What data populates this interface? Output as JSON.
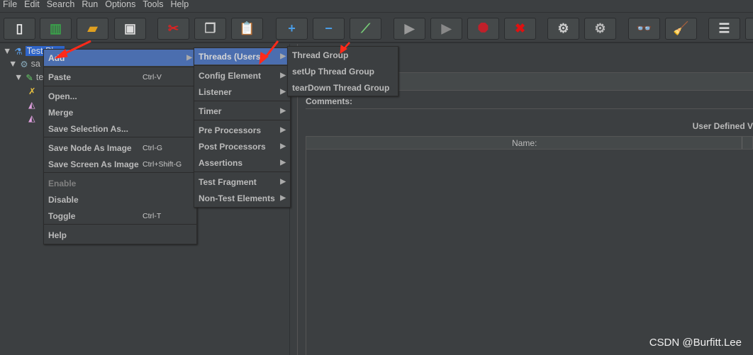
{
  "menubar": [
    "File",
    "Edit",
    "Search",
    "Run",
    "Options",
    "Tools",
    "Help"
  ],
  "toolbar": [
    {
      "icon": "new-icon",
      "g": "▯",
      "c": "#eee"
    },
    {
      "icon": "templates-icon",
      "g": "▥",
      "c": "#3aa34a"
    },
    {
      "icon": "open-icon",
      "g": "▰",
      "c": "#e0a020"
    },
    {
      "icon": "save-icon",
      "g": "▣",
      "c": "#ddd"
    },
    {
      "icon": "cut-icon",
      "g": "✂",
      "c": "#d22"
    },
    {
      "icon": "copy-icon",
      "g": "❐",
      "c": "#ccc"
    },
    {
      "icon": "paste-icon",
      "g": "📋",
      "c": "#c90"
    },
    {
      "icon": "expand-icon",
      "g": "+",
      "c": "#4a9ee8"
    },
    {
      "icon": "collapse-icon",
      "g": "−",
      "c": "#4a9ee8"
    },
    {
      "icon": "toggle-icon",
      "g": "⟋",
      "c": "#7c7"
    },
    {
      "icon": "start-icon",
      "g": "▶",
      "c": "#999"
    },
    {
      "icon": "start-no-pause-icon",
      "g": "▶",
      "c": "#888"
    },
    {
      "icon": "stop-icon",
      "g": "⯃",
      "c": "#c0202a"
    },
    {
      "icon": "shutdown-icon",
      "g": "✖",
      "c": "#e01010"
    },
    {
      "icon": "clear-icon",
      "g": "⚙",
      "c": "#ccc"
    },
    {
      "icon": "clear-all-icon",
      "g": "⚙",
      "c": "#bbb"
    },
    {
      "icon": "search-icon",
      "g": "👓",
      "c": "#222"
    },
    {
      "icon": "reset-search-icon",
      "g": "🧹",
      "c": "#e8c020"
    },
    {
      "icon": "function-helper-icon",
      "g": "☰",
      "c": "#ddd"
    },
    {
      "icon": "help-icon",
      "g": "?",
      "c": "#ddd"
    }
  ],
  "tree": {
    "root": "Test Plan",
    "child1": "sa",
    "child2": "te"
  },
  "context_menu": {
    "items": [
      {
        "label": "Add",
        "arrow": true,
        "hl": true
      },
      {
        "label": "Paste",
        "shortcut": "Ctrl-V"
      },
      {
        "label": "Open..."
      },
      {
        "label": "Merge"
      },
      {
        "label": "Save Selection As..."
      },
      {
        "label": "Save Node As Image",
        "shortcut": "Ctrl-G"
      },
      {
        "label": "Save Screen As Image",
        "shortcut": "Ctrl+Shift-G"
      },
      {
        "label": "Enable",
        "disabled": true
      },
      {
        "label": "Disable"
      },
      {
        "label": "Toggle",
        "shortcut": "Ctrl-T"
      },
      {
        "label": "Help"
      }
    ]
  },
  "add_submenu": {
    "items": [
      "Threads (Users)",
      "Config Element",
      "Listener",
      "Timer",
      "Pre Processors",
      "Post Processors",
      "Assertions",
      "Test Fragment",
      "Non-Test Elements"
    ]
  },
  "threads_submenu": {
    "items": [
      "Thread Group",
      "setUp Thread Group",
      "tearDown Thread Group"
    ]
  },
  "right": {
    "comments_label": "Comments:",
    "udv_label": "User Defined V",
    "name_col": "Name:"
  },
  "watermark": "CSDN @Burfitt.Lee",
  "colors": {
    "highlight": "#4b6eaf",
    "background": "#3c3f41",
    "arrow": "#ff2a1a"
  }
}
